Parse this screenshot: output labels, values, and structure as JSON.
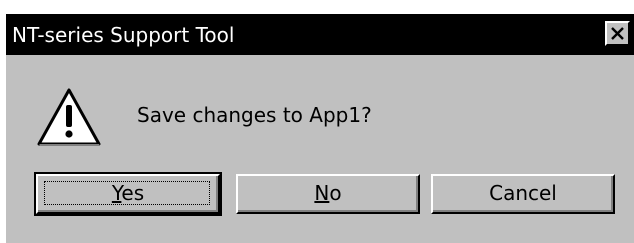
{
  "dialog": {
    "title": "NT-series Support Tool",
    "message": "Save changes to App1?",
    "icon": "warning-icon",
    "buttons": {
      "yes": {
        "mnemonic": "Y",
        "rest": "es"
      },
      "no": {
        "mnemonic": "N",
        "rest": "o"
      },
      "cancel": {
        "label": "Cancel"
      }
    }
  },
  "colors": {
    "titlebar": "#000000",
    "face": "#c0c0c0",
    "title_text": "#ffffff"
  }
}
